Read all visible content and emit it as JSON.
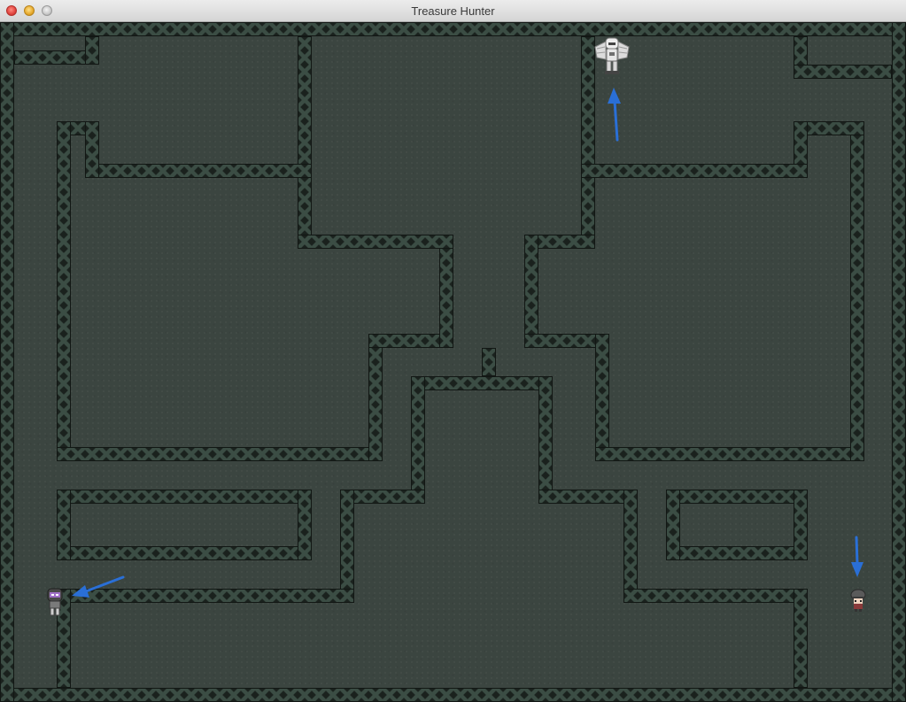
{
  "window": {
    "title": "Treasure Hunter",
    "buttons": [
      "close",
      "minimize",
      "zoom"
    ]
  },
  "game": {
    "floor_color": "#3b4540",
    "wall_color": "#1a211d",
    "annotation_color": "#2a6fd6",
    "characters": [
      {
        "name": "robot-boss",
        "icon": "winged-robot-icon"
      },
      {
        "name": "treasure-hunter",
        "icon": "hooded-hero-icon"
      },
      {
        "name": "purple-enemy",
        "icon": "purple-robot-icon"
      }
    ]
  }
}
